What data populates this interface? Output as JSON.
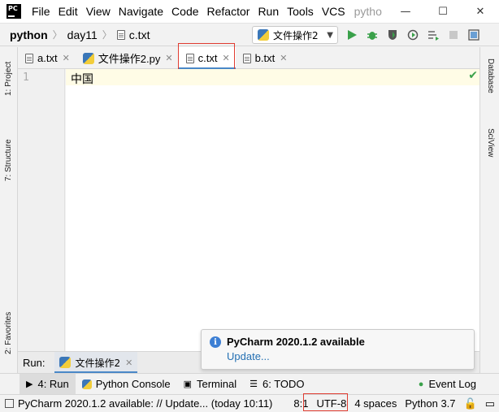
{
  "titlebar": {
    "logo_text": "PC",
    "menu": [
      "File",
      "Edit",
      "View",
      "Navigate",
      "Code",
      "Refactor",
      "Run",
      "Tools",
      "VCS"
    ],
    "menu_underline_first": true,
    "project_name": "pytho",
    "window_controls": {
      "minimize": "—",
      "maximize": "☐",
      "close": "✕"
    }
  },
  "navbar": {
    "breadcrumbs": [
      "python",
      "day11",
      "c.txt"
    ],
    "run_config": "文件操作2",
    "toolbar_icons": [
      "run-icon",
      "debug-icon",
      "coverage-icon",
      "profile-icon",
      "concurrency-icon",
      "stop-icon",
      "more-icon"
    ]
  },
  "left_tool_windows": [
    "1: Project",
    "7: Structure",
    "2: Favorites"
  ],
  "right_tool_windows": [
    "Database",
    "SciView"
  ],
  "editor_tabs": [
    {
      "label": "a.txt",
      "icon": "text-file-icon",
      "active": false
    },
    {
      "label": "文件操作2.py",
      "icon": "python-file-icon",
      "active": false
    },
    {
      "label": "c.txt",
      "icon": "text-file-icon",
      "active": true
    },
    {
      "label": "b.txt",
      "icon": "text-file-icon",
      "active": false
    }
  ],
  "editor": {
    "line_numbers": [
      "1"
    ],
    "lines": [
      "中国"
    ],
    "inspection_status": "ok"
  },
  "notification": {
    "title": "PyCharm 2020.1.2 available",
    "link": "Update..."
  },
  "run_window": {
    "label": "Run:",
    "tab": "文件操作2"
  },
  "tool_tabs": [
    {
      "label": "4: Run",
      "icon": "run-triangle-icon"
    },
    {
      "label": "Python Console",
      "icon": "python-console-icon"
    },
    {
      "label": "Terminal",
      "icon": "terminal-icon"
    },
    {
      "label": "6: TODO",
      "icon": "todo-icon"
    },
    {
      "label": "Event Log",
      "icon": "event-log-icon"
    }
  ],
  "statusbar": {
    "message": "PyCharm 2020.1.2 available: // Update... (today 10:11)",
    "position": "8:1",
    "encoding": "UTF-8",
    "indent": "4 spaces",
    "interpreter": "Python 3.7"
  },
  "colors": {
    "highlight_box": "#e03c31",
    "active_tab_underline": "#4a88c7",
    "run_green": "#3aa14a",
    "link_blue": "#2470b3"
  }
}
